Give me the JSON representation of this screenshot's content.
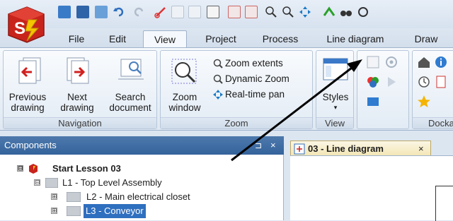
{
  "tabs": [
    "File",
    "Edit",
    "View",
    "Project",
    "Process",
    "Line diagram",
    "Draw"
  ],
  "active_tab": "View",
  "ribbon": {
    "navigation": {
      "label": "Navigation",
      "previous": [
        "Previous",
        "drawing"
      ],
      "next": [
        "Next",
        "drawing"
      ],
      "search": [
        "Search",
        "document"
      ]
    },
    "zoom": {
      "label": "Zoom",
      "zoom_window": [
        "Zoom",
        "window"
      ],
      "zoom_extents": "Zoom extents",
      "dynamic_zoom": "Dynamic Zoom",
      "realtime_pan": "Real-time pan"
    },
    "view": {
      "label": "View",
      "styles": "Styles"
    },
    "docking": {
      "label": "Docka"
    }
  },
  "components_panel": {
    "title": "Components",
    "tree": [
      {
        "label": "Start Lesson 03",
        "expander": "⊟",
        "bold": true
      },
      {
        "label": "L1 - Top Level Assembly",
        "expander": "⊟"
      },
      {
        "label": "L2 - Main electrical closet",
        "expander": "⊞"
      },
      {
        "label": "L3 - Conveyor",
        "expander": "⊞",
        "selected": true
      }
    ]
  },
  "document_tab": {
    "title": "03 - Line diagram"
  },
  "colors": {
    "panel_header": "#34639b",
    "selection": "#2f6fbf",
    "doc_tab": "#f3e6b4",
    "logo_red": "#c8241c"
  }
}
